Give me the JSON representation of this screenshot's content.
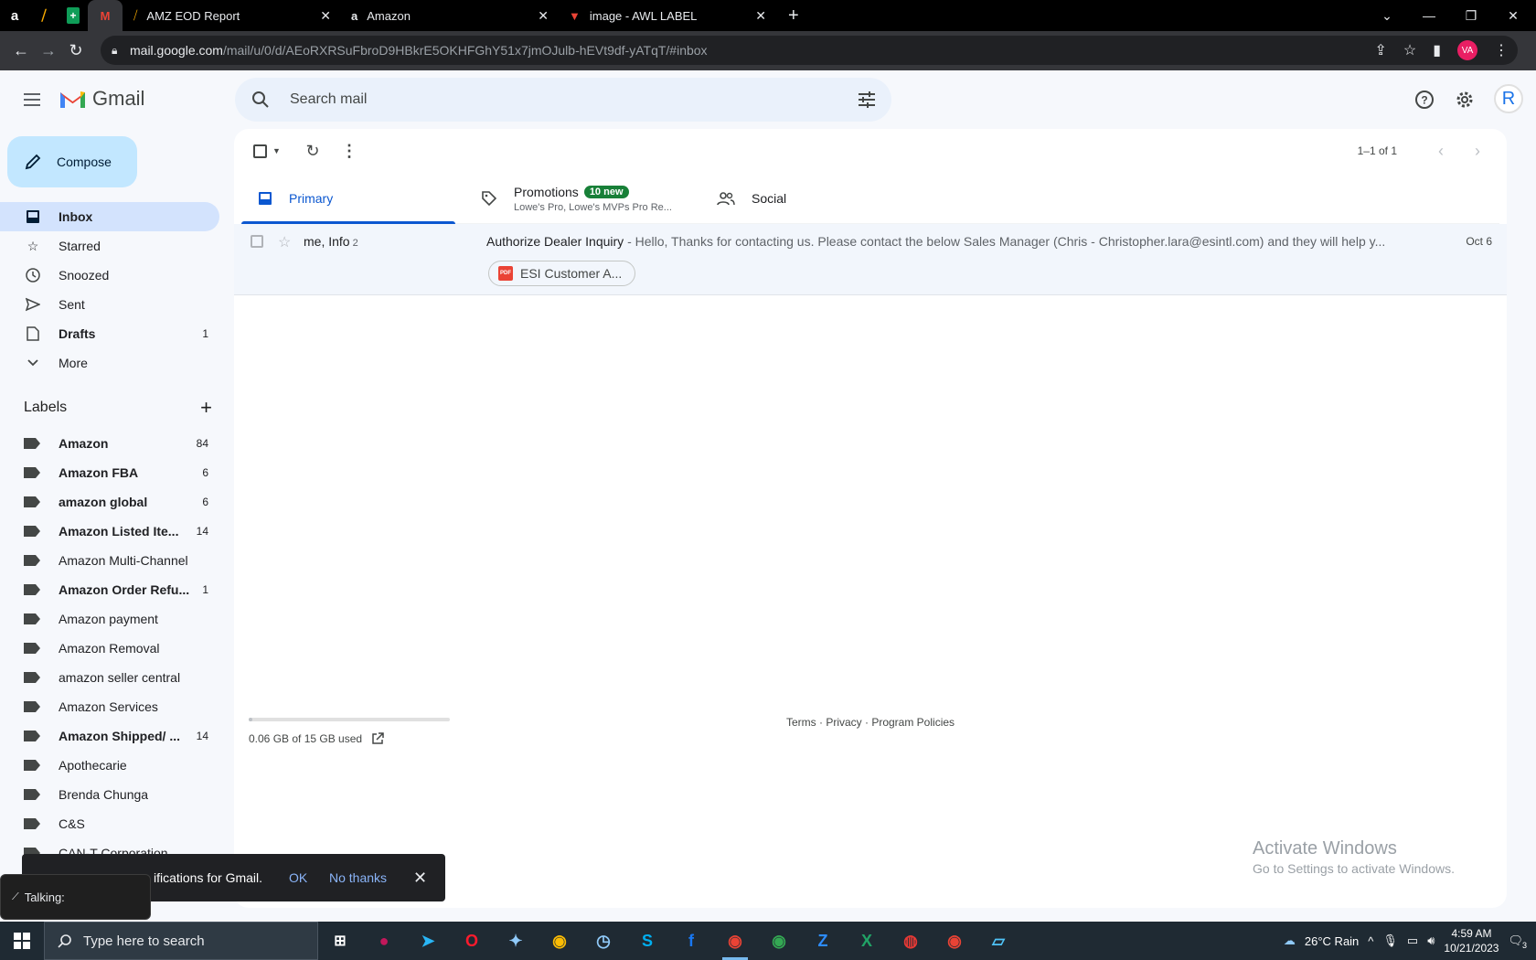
{
  "browser": {
    "tabs": [
      {
        "title": "AMZ EOD Report"
      },
      {
        "title": "Amazon"
      },
      {
        "title": "image - AWL LABEL"
      }
    ],
    "url_host": "mail.google.com",
    "url_path": "/mail/u/0/d/AEoRXRSuFbroD9HBkrE5OKHFGhY51x7jmOJulb-hEVt9df-yATqT/#inbox",
    "profile_initials": "VA"
  },
  "gmail": {
    "app_name": "Gmail",
    "search_placeholder": "Search mail",
    "account_initial": "R",
    "compose_label": "Compose",
    "nav": [
      {
        "label": "Inbox",
        "count": ""
      },
      {
        "label": "Starred",
        "count": ""
      },
      {
        "label": "Snoozed",
        "count": ""
      },
      {
        "label": "Sent",
        "count": ""
      },
      {
        "label": "Drafts",
        "count": "1"
      },
      {
        "label": "More",
        "count": ""
      }
    ],
    "labels_title": "Labels",
    "labels": [
      {
        "name": "Amazon",
        "count": "84"
      },
      {
        "name": "Amazon FBA",
        "count": "6"
      },
      {
        "name": "amazon global",
        "count": "6"
      },
      {
        "name": "Amazon Listed Ite...",
        "count": "14"
      },
      {
        "name": "Amazon Multi-Channel",
        "count": ""
      },
      {
        "name": "Amazon Order Refu...",
        "count": "1"
      },
      {
        "name": "Amazon payment",
        "count": ""
      },
      {
        "name": "Amazon Removal",
        "count": ""
      },
      {
        "name": "amazon seller central",
        "count": ""
      },
      {
        "name": "Amazon Services",
        "count": ""
      },
      {
        "name": "Amazon Shipped/ ...",
        "count": "14"
      },
      {
        "name": "Apothecarie",
        "count": ""
      },
      {
        "name": "Brenda Chunga",
        "count": ""
      },
      {
        "name": "C&S",
        "count": ""
      },
      {
        "name": "CAN-T Corporation",
        "count": ""
      }
    ],
    "pager": "1–1 of 1",
    "tabs": {
      "primary": "Primary",
      "promotions": "Promotions",
      "promotions_badge": "10 new",
      "promotions_sub": "Lowe's Pro, Lowe's MVPs Pro Re...",
      "social": "Social"
    },
    "emails": [
      {
        "sender": "me, Info",
        "thread_count": "2",
        "subject": "Authorize Dealer Inquiry",
        "snippet": " - Hello, Thanks for contacting us. Please contact the below Sales Manager (Chris - Christopher.lara@esintl.com) and they will help y...",
        "date": "Oct 6",
        "attachment": "ESI Customer A..."
      }
    ],
    "storage_text": "0.06 GB of 15 GB used",
    "storage_fraction": 0.004,
    "footer": "Terms · Privacy · Program Policies",
    "notification": {
      "text": "ificatio​ns for Gmail.",
      "ok": "OK",
      "no_thanks": "No thanks"
    }
  },
  "overlay": {
    "activate_title": "Activate Windows",
    "activate_sub": "Go to Settings to activate Windows.",
    "talking": "Talking:"
  },
  "taskbar": {
    "search_placeholder": "Type here to search",
    "weather": "26°C  Rain",
    "time": "4:59 AM",
    "date": "10/21/2023",
    "notif_count": "3"
  },
  "colors": {
    "gmail_bg": "#f6f8fc",
    "compose": "#c2e7ff",
    "inbox_active": "#d3e3fd",
    "primary_blue": "#0b57d0",
    "badge_green": "#188038"
  }
}
